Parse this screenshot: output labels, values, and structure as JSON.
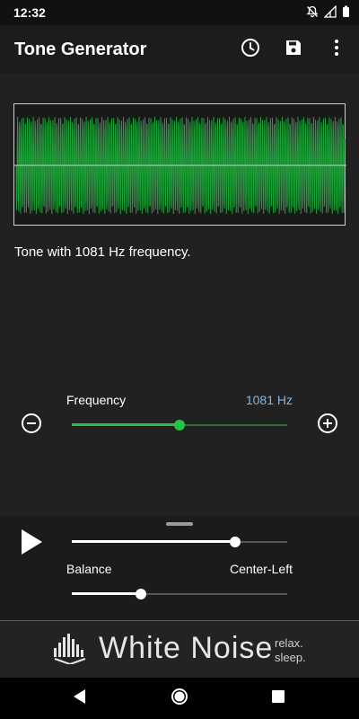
{
  "status_bar": {
    "time": "12:32",
    "icons": [
      "notifications-off-icon",
      "signal-icon",
      "battery-icon"
    ]
  },
  "app_bar": {
    "title": "Tone Generator",
    "actions": [
      "timer-icon",
      "save-icon",
      "more-options-icon"
    ]
  },
  "waveform": {
    "wave_color": "#1fa03a",
    "axis_color": "#d0d0d0"
  },
  "tone_description": "Tone with 1081 Hz frequency.",
  "frequency": {
    "label": "Frequency",
    "value_text": "1081 Hz",
    "level": 0.5,
    "accent_color": "#22c447",
    "value_color": "#7fb8e6"
  },
  "controls": {
    "volume_level": 0.76,
    "balance_label": "Balance",
    "balance_value": "Center-Left",
    "balance_level": 0.32
  },
  "ad": {
    "title": "White Noise",
    "tagline_line1": "relax.",
    "tagline_line2": "sleep."
  },
  "nav": [
    "back-icon",
    "home-icon",
    "recents-icon"
  ]
}
